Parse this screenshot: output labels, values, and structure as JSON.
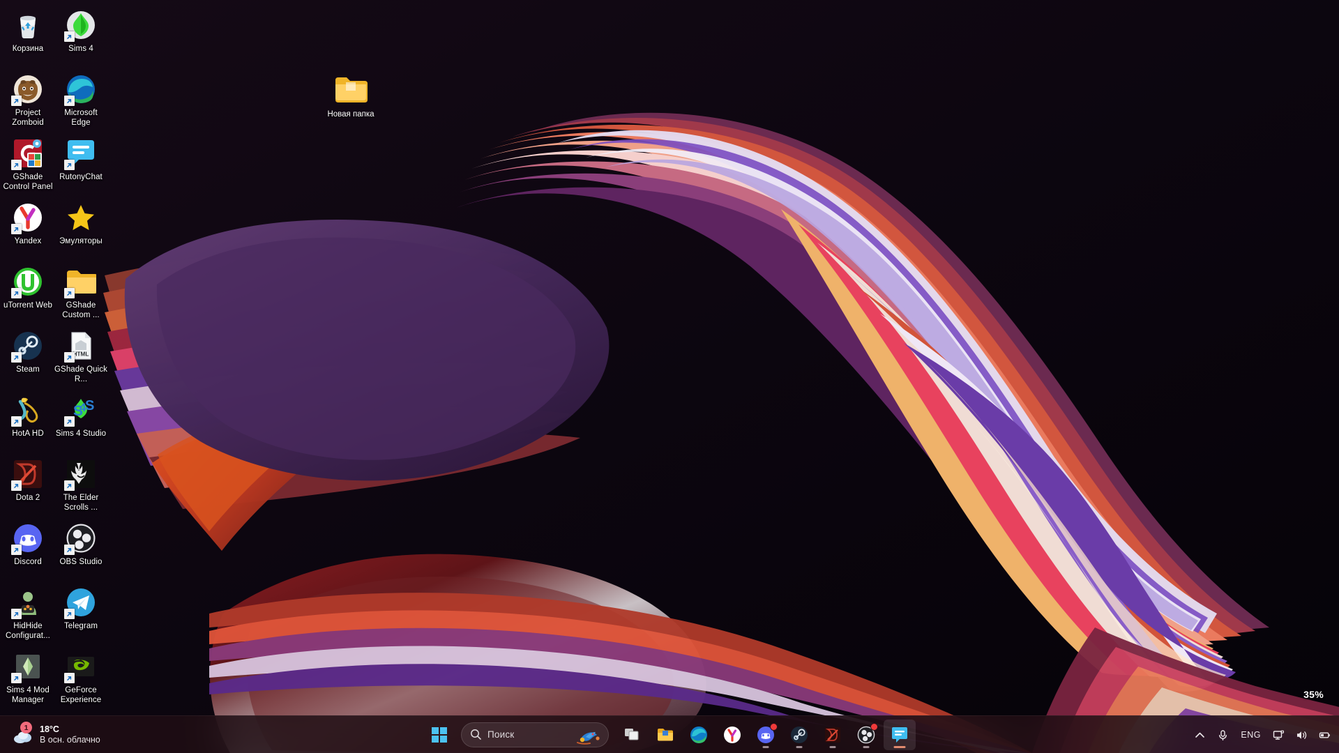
{
  "desktop": {
    "zoom_indicator": "35%",
    "icons": [
      {
        "label": "Корзина",
        "icon": "recycle-bin-icon",
        "shortcut": false
      },
      {
        "label": "Sims 4",
        "icon": "sims-4-icon",
        "shortcut": true
      },
      {
        "label": "Project Zomboid",
        "icon": "project-zomboid-icon",
        "shortcut": true
      },
      {
        "label": "Microsoft Edge",
        "icon": "microsoft-edge-icon",
        "shortcut": true
      },
      {
        "label": "GShade Control Panel",
        "icon": "gshade-control-panel-icon",
        "shortcut": true
      },
      {
        "label": "RutonyChat",
        "icon": "rutonychat-icon",
        "shortcut": true
      },
      {
        "label": "Yandex",
        "icon": "yandex-browser-icon",
        "shortcut": true
      },
      {
        "label": "Эмуляторы",
        "icon": "star-folder-icon",
        "shortcut": false
      },
      {
        "label": "uTorrent Web",
        "icon": "utorrent-web-icon",
        "shortcut": true
      },
      {
        "label": "GShade Custom ...",
        "icon": "folder-icon",
        "shortcut": true
      },
      {
        "label": "Steam",
        "icon": "steam-icon",
        "shortcut": true
      },
      {
        "label": "GShade Quick R...",
        "icon": "html-file-icon",
        "shortcut": true
      },
      {
        "label": "HotA HD",
        "icon": "hota-hd-icon",
        "shortcut": true
      },
      {
        "label": "Sims 4 Studio",
        "icon": "sims-4-studio-icon",
        "shortcut": true
      },
      {
        "label": "Dota 2",
        "icon": "dota-2-icon",
        "shortcut": true
      },
      {
        "label": "The Elder Scrolls ...",
        "icon": "skyrim-icon",
        "shortcut": true
      },
      {
        "label": "Discord",
        "icon": "discord-icon",
        "shortcut": true
      },
      {
        "label": "OBS Studio",
        "icon": "obs-studio-icon",
        "shortcut": true
      },
      {
        "label": "HidHide Configurat...",
        "icon": "hidhide-icon",
        "shortcut": true
      },
      {
        "label": "Telegram",
        "icon": "telegram-icon",
        "shortcut": true
      },
      {
        "label": "Sims 4 Mod Manager",
        "icon": "sims-4-mod-manager-icon",
        "shortcut": true
      },
      {
        "label": "GeForce Experience",
        "icon": "geforce-experience-icon",
        "shortcut": true
      }
    ],
    "loose_icon": {
      "label": "Новая папка",
      "icon": "folder-icon",
      "shortcut": false
    }
  },
  "taskbar": {
    "weather": {
      "temperature": "18°C",
      "condition": "В осн. облачно",
      "badge_count": "1",
      "icon": "cloud-icon"
    },
    "start": {
      "label": "Пуск",
      "icon": "windows-logo-icon"
    },
    "search": {
      "placeholder": "Поиск",
      "icon": "search-icon",
      "art": "bird-illustration-icon"
    },
    "pinned": [
      {
        "label": "Представление задач",
        "icon": "task-view-icon",
        "running": false,
        "active": false,
        "badge": false
      },
      {
        "label": "Проводник",
        "icon": "file-explorer-icon",
        "running": true,
        "active": false,
        "badge": false
      },
      {
        "label": "Microsoft Edge",
        "icon": "microsoft-edge-icon",
        "running": true,
        "active": false,
        "badge": false
      },
      {
        "label": "Yandex",
        "icon": "yandex-browser-icon",
        "running": true,
        "active": false,
        "badge": false
      },
      {
        "label": "Discord",
        "icon": "discord-icon",
        "running": true,
        "active": false,
        "badge": true
      },
      {
        "label": "Steam",
        "icon": "steam-icon",
        "running": true,
        "active": false,
        "badge": false
      },
      {
        "label": "Dota 2",
        "icon": "dota-2-icon",
        "running": true,
        "active": false,
        "badge": false
      },
      {
        "label": "OBS Studio",
        "icon": "obs-studio-icon",
        "running": true,
        "active": false,
        "badge": true
      },
      {
        "label": "RutonyChat",
        "icon": "rutonychat-icon",
        "running": true,
        "active": true,
        "badge": false
      }
    ],
    "tray": {
      "overflow": {
        "label": "Показать скрытые значки",
        "icon": "chevron-up-icon"
      },
      "microphone": {
        "label": "Микрофон",
        "icon": "microphone-icon"
      },
      "language": {
        "label": "ENG",
        "icon": "language-indicator"
      },
      "network": {
        "label": "Сеть",
        "icon": "network-display-icon"
      },
      "volume": {
        "label": "Громкость",
        "icon": "speaker-icon"
      },
      "battery": {
        "label": "Батарея",
        "icon": "battery-icon"
      }
    }
  },
  "colors": {
    "taskbar_bg": "#200e14",
    "accent_blue": "#4cc2f1",
    "badge_red": "#f03a3a",
    "weather_badge": "#f16b7c",
    "active_indicator": "#e08a6e"
  }
}
